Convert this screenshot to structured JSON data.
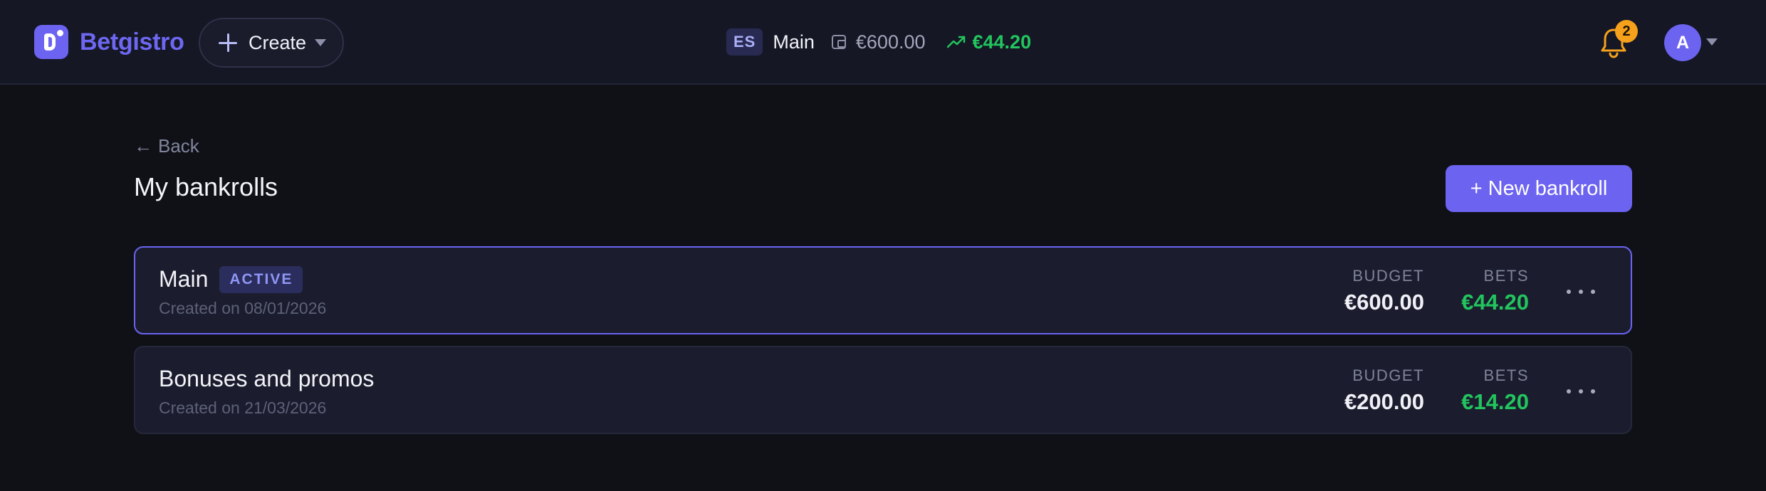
{
  "app": {
    "brand_name": "Betgistro"
  },
  "header": {
    "create_label": "Create",
    "region_code": "ES",
    "current_bankroll": "Main",
    "budget": "€600.00",
    "profit": "€44.20",
    "notifications_count": "2",
    "avatar_initial": "A"
  },
  "page": {
    "back_label": "Back",
    "title": "My bankrolls",
    "new_button_label": "+ New bankroll"
  },
  "bankrolls": [
    {
      "name": "Main",
      "badge": "ACTIVE",
      "created": "Created on 08/01/2026",
      "budget_caption": "BUDGET",
      "budget": "€600.00",
      "bets_caption": "BETS",
      "bets": "€44.20"
    },
    {
      "name": "Bonuses and promos",
      "created": "Created on 21/03/2026",
      "budget_caption": "BUDGET",
      "budget": "€200.00",
      "bets_caption": "BETS",
      "bets": "€14.20"
    }
  ],
  "icons": {
    "create": "plus-icon",
    "wallet": "wallet-icon",
    "trend": "trending-up-icon",
    "bell": "bell-icon",
    "more": "more-horizontal-icon",
    "back": "arrow-left-icon"
  },
  "colors": {
    "accent": "#6c63f0",
    "positive": "#22c55e",
    "notification": "#f6a11c",
    "background": "#101117",
    "card": "#1b1d2e"
  }
}
